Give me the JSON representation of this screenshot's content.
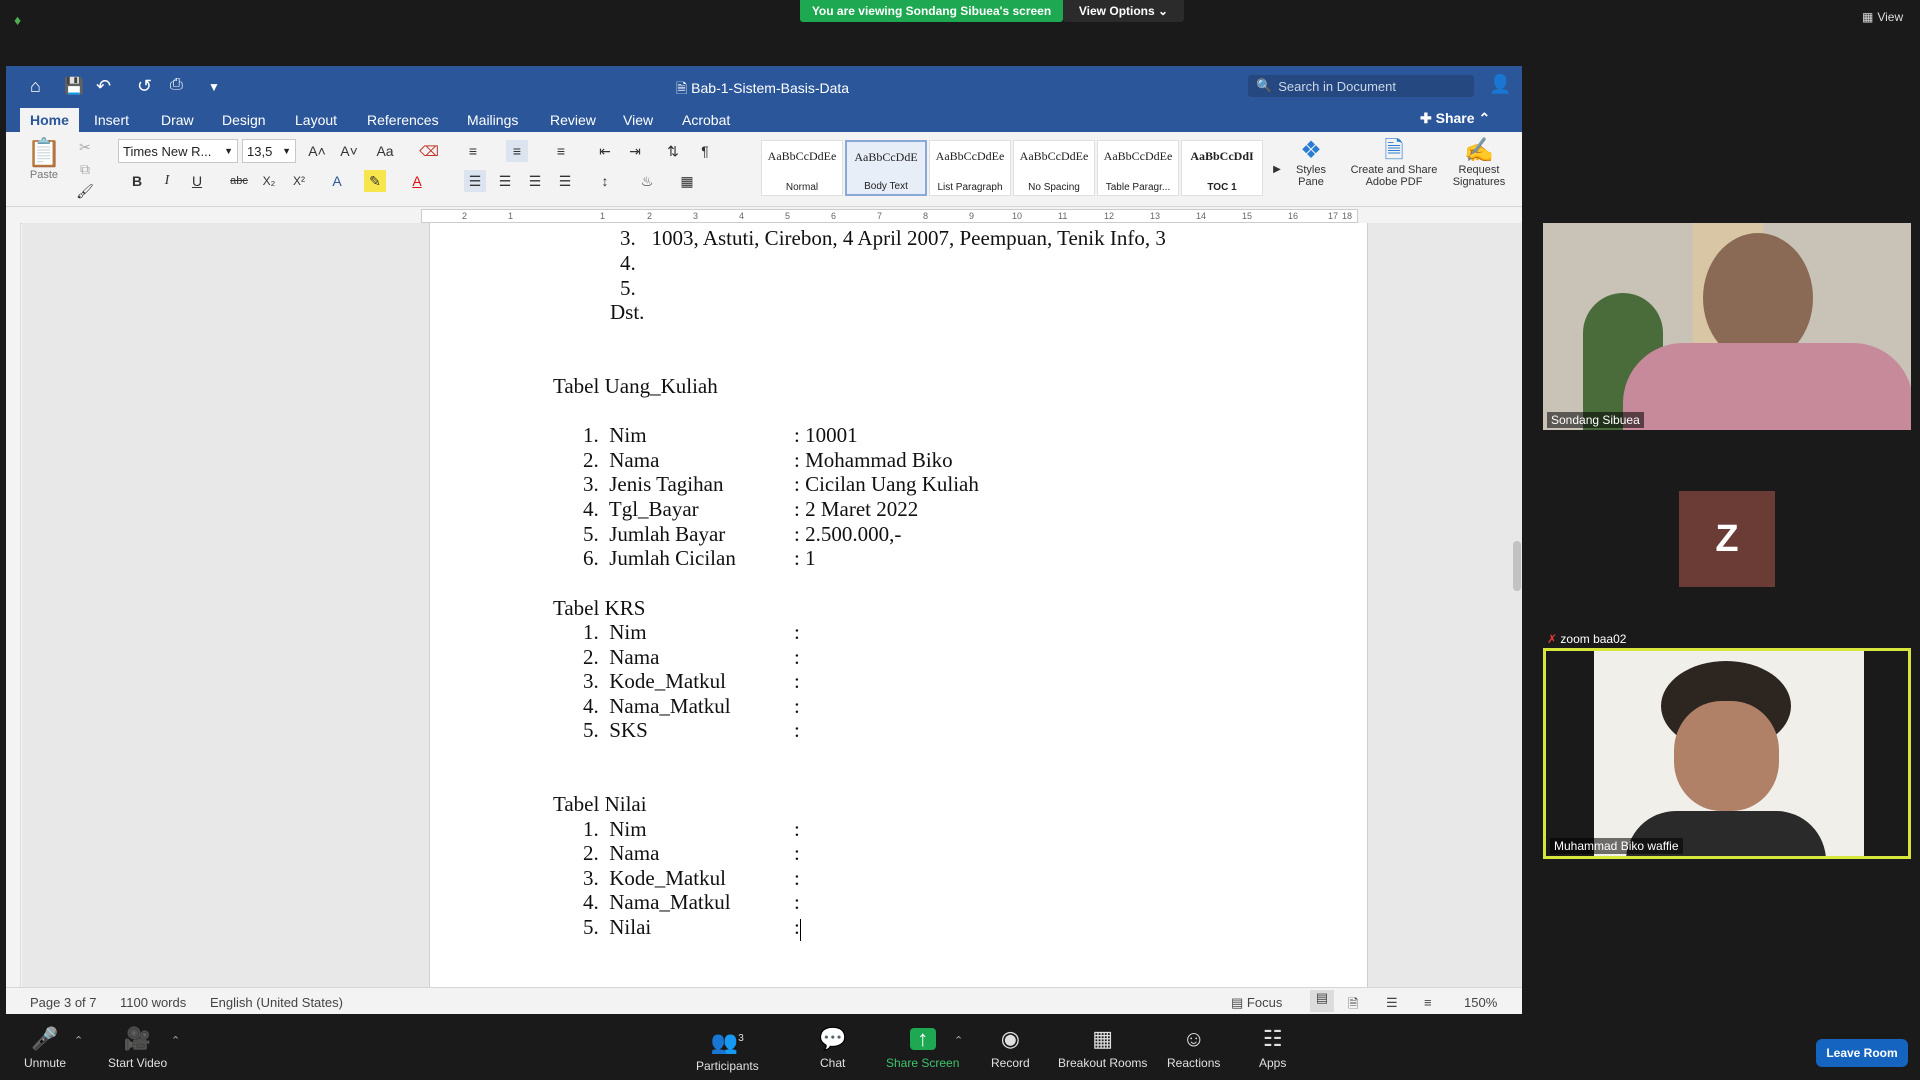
{
  "zoom_top": {
    "viewing_banner": "You are viewing Sondang Sibuea's screen",
    "view_options": "View Options",
    "view_label": "View"
  },
  "word": {
    "document_title": "Bab-1-Sistem-Basis-Data",
    "search_placeholder": "Search in Document",
    "tabs": [
      "Home",
      "Insert",
      "Draw",
      "Design",
      "Layout",
      "References",
      "Mailings",
      "Review",
      "View",
      "Acrobat"
    ],
    "active_tab": "Home",
    "share_label": "Share",
    "ribbon": {
      "paste_label": "Paste",
      "font_name": "Times New R...",
      "font_size": "13,5",
      "styles": [
        {
          "preview": "AaBbCcDdEe",
          "name": "Normal"
        },
        {
          "preview": "AaBbCcDdE",
          "name": "Body Text"
        },
        {
          "preview": "AaBbCcDdEe",
          "name": "List Paragraph"
        },
        {
          "preview": "AaBbCcDdEe",
          "name": "No Spacing"
        },
        {
          "preview": "AaBbCcDdEe",
          "name": "Table Paragr..."
        },
        {
          "preview": "AaBbCcDdI",
          "name": "TOC 1"
        }
      ],
      "styles_pane": "Styles Pane",
      "create_share_pdf": "Create and Share Adobe PDF",
      "request_signatures": "Request Signatures"
    },
    "ruler_numbers": [
      "2",
      "1",
      "1",
      "2",
      "3",
      "4",
      "5",
      "6",
      "7",
      "8",
      "9",
      "10",
      "11",
      "12",
      "13",
      "14",
      "15",
      "16",
      "17",
      "18"
    ],
    "document_lines": [
      "3.   1003, Astuti, Cirebon, 4 April 2007, Peempuan, Tenik Info, 3",
      "4.",
      "5.",
      "Dst.",
      "Tabel Uang_Kuliah",
      "1.  Nim",
      ": 10001",
      "2.  Nama",
      ": Mohammad Biko",
      "3.  Jenis Tagihan",
      ": Cicilan Uang Kuliah",
      "4.  Tgl_Bayar",
      ": 2 Maret 2022",
      "5.  Jumlah Bayar",
      ": 2.500.000,-",
      "6.  Jumlah Cicilan",
      ": 1",
      "Tabel KRS",
      "1.  Nim",
      "2.  Nama",
      "3.  Kode_Matkul",
      "4.  Nama_Matkul",
      "5.  SKS",
      "Tabel Nilai",
      "1.  Nim",
      "2.  Nama",
      "3.  Kode_Matkul",
      "4.  Nama_Matkul",
      "5.  Nilai",
      ":"
    ],
    "status": {
      "page": "Page 3 of 7",
      "words": "1100 words",
      "language": "English (United States)",
      "focus": "Focus",
      "zoom": "150%"
    }
  },
  "participants_panel": [
    {
      "name": "Sondang Sibuea"
    },
    {
      "name": "zoom baa02",
      "initial": "Z"
    },
    {
      "name": "Muhammad Biko waffie"
    }
  ],
  "bottom_bar": {
    "unmute": "Unmute",
    "start_video": "Start Video",
    "participants": "Participants",
    "participants_count": "3",
    "chat": "Chat",
    "share_screen": "Share Screen",
    "record": "Record",
    "breakout_rooms": "Breakout Rooms",
    "reactions": "Reactions",
    "apps": "Apps",
    "leave_room": "Leave Room"
  },
  "colors": {
    "word_blue": "#2b579a",
    "zoom_green": "#1da851",
    "leave_blue": "#1565c0",
    "active_speaker": "#d6e63a"
  }
}
